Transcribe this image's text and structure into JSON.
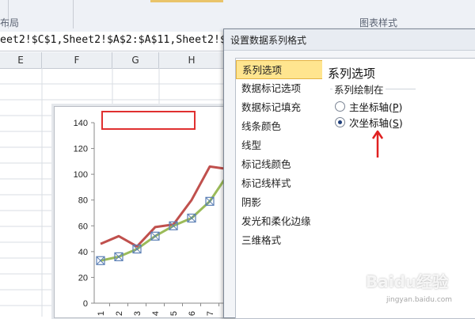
{
  "ribbon": {
    "left_label": "布局",
    "right_label": "图表样式"
  },
  "formula_bar": {
    "text": "eet2!$C$1,Sheet2!$A$2:$A$11,Sheet2!$"
  },
  "columns": [
    "E",
    "F",
    "G",
    "H"
  ],
  "dialog": {
    "title": "设置数据系列格式",
    "nav_items": [
      "系列选项",
      "数据标记选项",
      "数据标记填充",
      "线条颜色",
      "线型",
      "标记线颜色",
      "标记线样式",
      "阴影",
      "发光和柔化边缘",
      "三维格式"
    ],
    "selected_nav": "系列选项",
    "pane_title": "系列选项",
    "group_label": "系列绘制在",
    "primary_axis": {
      "label": "主坐标轴",
      "key": "P"
    },
    "secondary_axis": {
      "label": "次坐标轴",
      "key": "S"
    },
    "selected_axis": "secondary"
  },
  "chart_data": {
    "type": "line",
    "yticks": [
      "0",
      "20",
      "40",
      "60",
      "80",
      "100",
      "120",
      "140"
    ],
    "ylim": [
      0,
      140
    ],
    "categories": [
      "1",
      "2",
      "3",
      "4",
      "5",
      "6",
      "7"
    ],
    "series": [
      {
        "values": [
          46,
          52,
          44,
          59,
          61,
          80,
          106,
          104
        ],
        "color": "#c0504d",
        "selected": false
      },
      {
        "values": [
          33,
          36,
          42,
          52,
          60,
          66,
          79,
          100
        ],
        "color": "#9bbb59",
        "selected": true
      }
    ]
  },
  "watermark": {
    "text": "Baidu经验",
    "sub": "jingyan.baidu.com"
  }
}
